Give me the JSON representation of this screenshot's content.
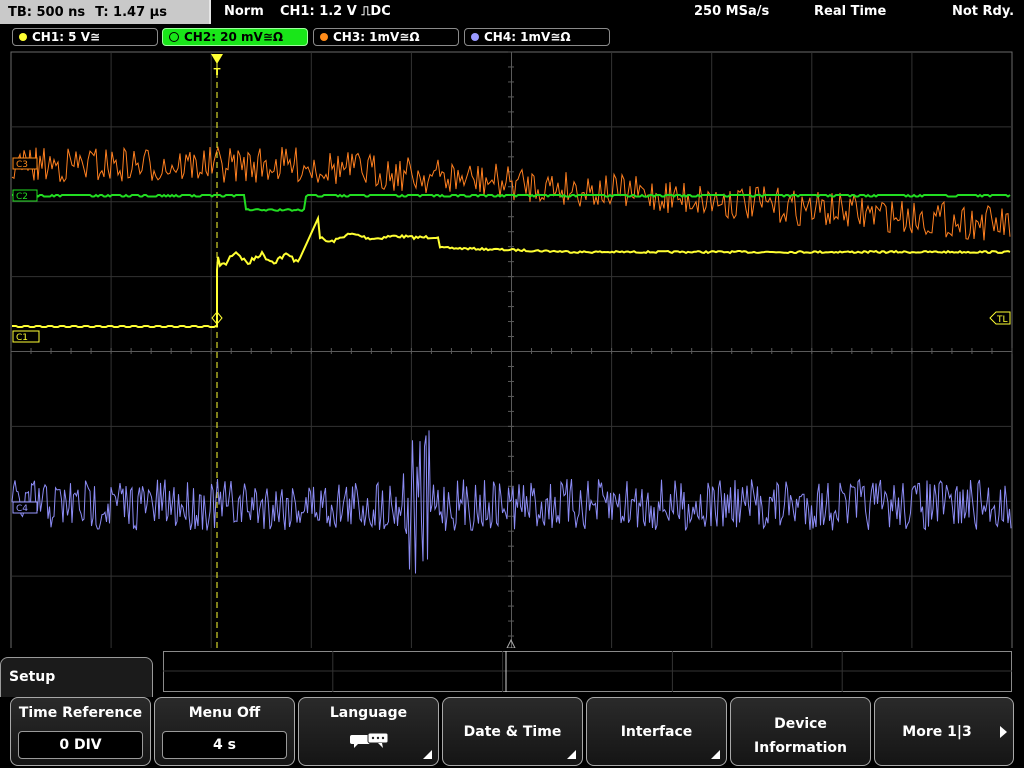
{
  "status": {
    "timebase": "TB: 500 ns",
    "trigger_time": "T: 1.47 µs",
    "mode": "Norm",
    "trigger_setting": "CH1: 1.2 V ⎍DC",
    "sample_rate": "250 MSa/s",
    "acq_mode": "Real Time",
    "state": "Not Rdy."
  },
  "channels": [
    {
      "label": "CH1: 5 V≅",
      "color": "#ffff33"
    },
    {
      "label": "CH2: 20 mV≅Ω",
      "color": "#22dd22"
    },
    {
      "label": "CH3: 1mV≅Ω",
      "color": "#ff8c1a"
    },
    {
      "label": "CH4: 1mV≅Ω",
      "color": "#9999ff"
    }
  ],
  "markers": {
    "c3": "C3",
    "c2": "C2",
    "c1": "C1",
    "c4": "C4",
    "trigger_level": "TL",
    "trigger_pos": "T"
  },
  "menu": {
    "title": "Setup",
    "keys": {
      "time_reference": {
        "label": "Time Reference",
        "value": "0 DIV"
      },
      "menu_off": {
        "label": "Menu Off",
        "value": "4 s"
      },
      "language": {
        "label": "Language"
      },
      "date_time": {
        "label": "Date & Time"
      },
      "interface": {
        "label": "Interface"
      },
      "device_information": {
        "line1": "Device",
        "line2": "Information"
      },
      "more": {
        "label": "More 1|3"
      }
    }
  }
}
